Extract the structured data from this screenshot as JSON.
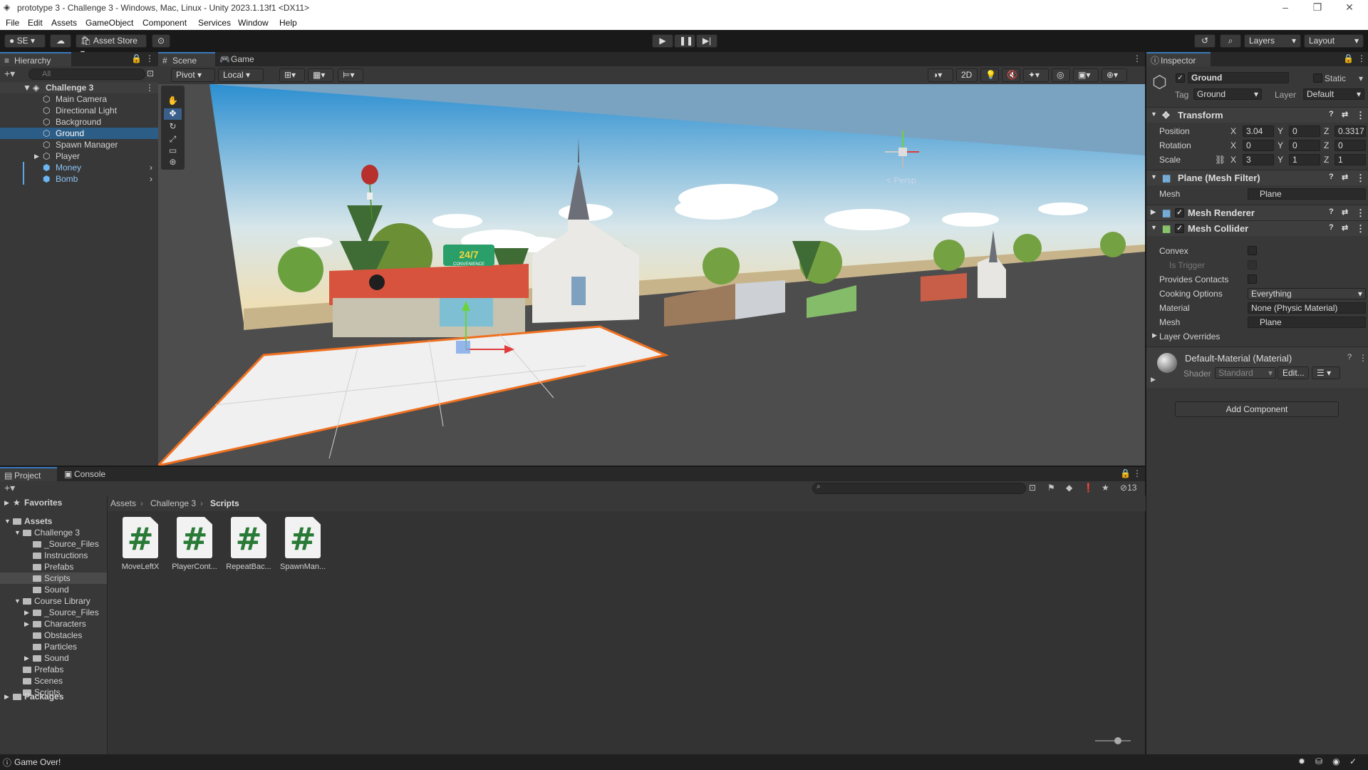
{
  "window": {
    "title": "prototype 3 - Challenge 3 - Windows, Mac, Linux - Unity 2023.1.13f1 <DX11>"
  },
  "menu": [
    "File",
    "Edit",
    "Assets",
    "GameObject",
    "Component",
    "Services",
    "Window",
    "Help"
  ],
  "toolbar": {
    "account": "SE",
    "asset_store": "Asset Store",
    "layers": "Layers",
    "layout": "Layout"
  },
  "hierarchy": {
    "tab": "Hierarchy",
    "search_placeholder": "All",
    "scene": "Challenge 3",
    "items": [
      "Main Camera",
      "Directional Light",
      "Background",
      "Ground",
      "Spawn Manager",
      "Player",
      "Money",
      "Bomb"
    ],
    "selected": "Ground"
  },
  "scene": {
    "tabs": [
      "Scene",
      "Game"
    ],
    "pivot": "Pivot",
    "space": "Local",
    "mode_2d": "2D",
    "persp": "< Persp",
    "store_sign": "24/7",
    "store_sub": "CONVENIENCE"
  },
  "inspector": {
    "tab": "Inspector",
    "object_name": "Ground",
    "static_label": "Static",
    "tag_label": "Tag",
    "tag": "Ground",
    "layer_label": "Layer",
    "layer": "Default",
    "transform": {
      "title": "Transform",
      "position_label": "Position",
      "px": "3.04",
      "py": "0",
      "pz": "0.3317",
      "rotation_label": "Rotation",
      "rx": "0",
      "ry": "0",
      "rz": "0",
      "scale_label": "Scale",
      "sx": "3",
      "sy": "1",
      "sz": "1"
    },
    "mesh_filter": {
      "title": "Plane (Mesh Filter)",
      "mesh_label": "Mesh",
      "mesh": "Plane"
    },
    "mesh_renderer": {
      "title": "Mesh Renderer"
    },
    "mesh_collider": {
      "title": "Mesh Collider",
      "convex": "Convex",
      "is_trigger": "Is Trigger",
      "provides_contacts": "Provides Contacts",
      "cooking_label": "Cooking Options",
      "cooking": "Everything",
      "material_label": "Material",
      "material": "None (Physic Material)",
      "mesh_label": "Mesh",
      "mesh": "Plane"
    },
    "layer_overrides": "Layer Overrides",
    "material": {
      "name": "Default-Material (Material)",
      "shader_label": "Shader",
      "shader": "Standard",
      "edit": "Edit..."
    },
    "add_component": "Add Component"
  },
  "project": {
    "tabs": [
      "Project",
      "Console"
    ],
    "hidden_count": "13",
    "breadcrumb": [
      "Assets",
      "Challenge 3",
      "Scripts"
    ],
    "favorites": "Favorites",
    "tree": [
      {
        "label": "Assets",
        "level": 0,
        "bold": true
      },
      {
        "label": "Challenge 3",
        "level": 1
      },
      {
        "label": "_Source_Files",
        "level": 2
      },
      {
        "label": "Instructions",
        "level": 2
      },
      {
        "label": "Prefabs",
        "level": 2
      },
      {
        "label": "Scripts",
        "level": 2,
        "selected": true
      },
      {
        "label": "Sound",
        "level": 2
      },
      {
        "label": "Course Library",
        "level": 1
      },
      {
        "label": "_Source_Files",
        "level": 2
      },
      {
        "label": "Characters",
        "level": 2
      },
      {
        "label": "Obstacles",
        "level": 2
      },
      {
        "label": "Particles",
        "level": 2
      },
      {
        "label": "Sound",
        "level": 2
      },
      {
        "label": "Prefabs",
        "level": 1
      },
      {
        "label": "Scenes",
        "level": 1
      },
      {
        "label": "Scripts",
        "level": 1
      }
    ],
    "packages": "Packages",
    "assets": [
      "MoveLeftX",
      "PlayerCont...",
      "RepeatBac...",
      "SpawnMan..."
    ]
  },
  "status": {
    "message": "Game Over!"
  }
}
